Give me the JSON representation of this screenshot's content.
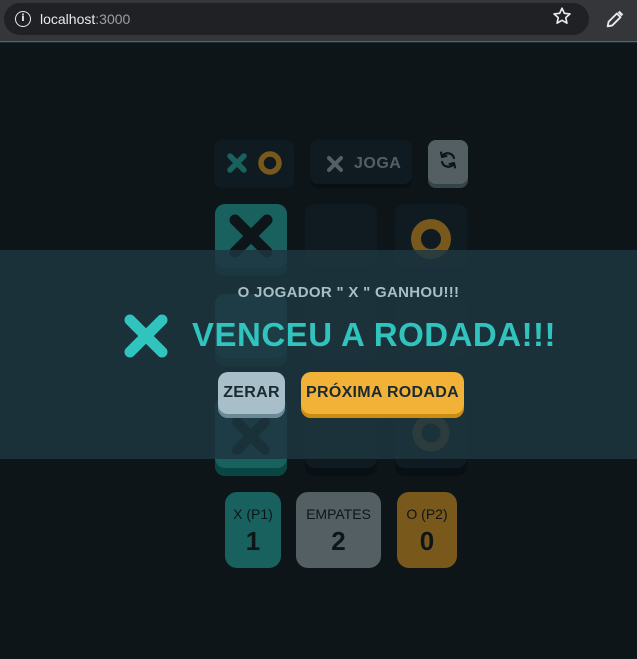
{
  "browser": {
    "url_host": "localhost",
    "url_port": ":3000",
    "info_icon": "info-icon",
    "bookmark_icon": "star-icon",
    "extension_icon": "pen-icon"
  },
  "game": {
    "turn_label": "JOGA",
    "turn_icon": "x-icon",
    "restart_icon": "restart-icon",
    "board": [
      [
        "X",
        "",
        "O"
      ],
      [
        "X",
        "",
        ""
      ],
      [
        "X",
        "",
        "O"
      ]
    ],
    "winning_cells": [
      [
        0,
        0
      ],
      [
        1,
        0
      ],
      [
        2,
        0
      ]
    ],
    "scores": [
      {
        "label": "X (P1)",
        "value": "1",
        "color": "#31c3bd"
      },
      {
        "label": "EMPATES",
        "value": "2",
        "color": "#a8bfc9"
      },
      {
        "label": "O (P2)",
        "value": "0",
        "color": "#f2b137"
      }
    ]
  },
  "modal": {
    "message": "O JOGADOR \" X \" GANHOU!!!",
    "title": "VENCEU A RODADA!!!",
    "winner_icon": "x-icon",
    "quit_label": "ZERAR",
    "next_label": "PRÓXIMA RODADA"
  },
  "colors": {
    "background": "#1a2a33",
    "x": "#31c3bd",
    "o": "#f2b137",
    "silver": "#a8bfc9",
    "panel": "#1f3641"
  }
}
